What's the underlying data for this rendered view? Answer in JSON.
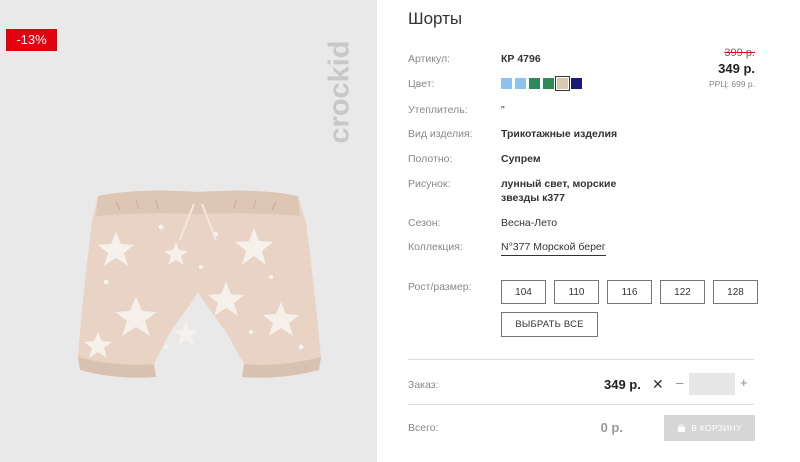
{
  "product": {
    "title": "Шорты",
    "discount": "-13%",
    "brand": "crockid",
    "old_price": "399 р.",
    "price": "349 р.",
    "rrp": "РРЦ: 699 р."
  },
  "details": {
    "article_label": "Артикул:",
    "article_value": "КР 4796",
    "color_label": "Цвет:",
    "colors": [
      "#8ec3f0",
      "#8ec3f0",
      "#2f8a5a",
      "#2f8a5a",
      "#d9c8b0",
      "#1a1a7a"
    ],
    "insulation_label": "Утеплитель:",
    "insulation_value": "\"",
    "type_label": "Вид изделия:",
    "type_value": "Трикотажные изделия",
    "fabric_label": "Полотно:",
    "fabric_value": "Супрем",
    "pattern_label": "Рисунок:",
    "pattern_value_line1": "лунный свет, морские",
    "pattern_value_line2": "звезды к377",
    "season_label": "Сезон:",
    "season_value": "Весна-Лето",
    "collection_label": "Коллекция:",
    "collection_value": "N°377 Морской берег"
  },
  "sizes": {
    "label": "Рост/размер:",
    "options": [
      "104",
      "110",
      "116",
      "122",
      "128"
    ],
    "select_all": "ВЫБРАТЬ ВСЕ"
  },
  "order": {
    "label": "Заказ:",
    "price": "349 р.",
    "times": "✕",
    "minus": "–",
    "plus": "+",
    "quantity": ""
  },
  "total": {
    "label": "Всего:",
    "value": "0 р.",
    "cart_button": "В КОРЗИНУ"
  },
  "icons": {
    "cart": "cart-icon"
  }
}
